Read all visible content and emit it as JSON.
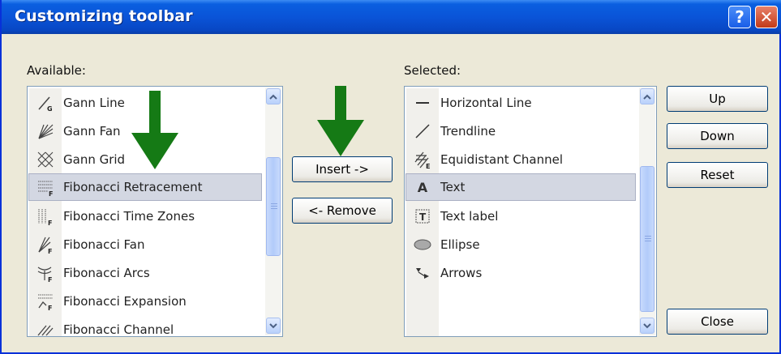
{
  "window": {
    "title": "Customizing toolbar",
    "help_label": "?",
    "close_label": "✕"
  },
  "available": {
    "label": "Available:",
    "items": [
      {
        "label": "Gann Line",
        "icon": "gann-line-icon"
      },
      {
        "label": "Gann Fan",
        "icon": "gann-fan-icon"
      },
      {
        "label": "Gann Grid",
        "icon": "gann-grid-icon"
      },
      {
        "label": "Fibonacci Retracement",
        "icon": "fibonacci-retracement-icon",
        "selected": true
      },
      {
        "label": "Fibonacci Time Zones",
        "icon": "fibonacci-time-zones-icon"
      },
      {
        "label": "Fibonacci Fan",
        "icon": "fibonacci-fan-icon"
      },
      {
        "label": "Fibonacci Arcs",
        "icon": "fibonacci-arcs-icon"
      },
      {
        "label": "Fibonacci Expansion",
        "icon": "fibonacci-expansion-icon"
      },
      {
        "label": "Fibonacci Channel",
        "icon": "fibonacci-channel-icon"
      }
    ]
  },
  "selected": {
    "label": "Selected:",
    "items": [
      {
        "label": "Horizontal Line",
        "icon": "horizontal-line-icon"
      },
      {
        "label": "Trendline",
        "icon": "trendline-icon"
      },
      {
        "label": "Equidistant Channel",
        "icon": "equidistant-channel-icon"
      },
      {
        "label": "Text",
        "icon": "text-icon",
        "selected": true
      },
      {
        "label": "Text label",
        "icon": "text-label-icon"
      },
      {
        "label": "Ellipse",
        "icon": "ellipse-icon"
      },
      {
        "label": "Arrows",
        "icon": "arrows-icon"
      }
    ]
  },
  "buttons": {
    "insert": "Insert ->",
    "remove": "<- Remove",
    "up": "Up",
    "down": "Down",
    "reset": "Reset",
    "close": "Close"
  },
  "colors": {
    "title_bar": "#0a54d8",
    "selection": "#d3d7e2",
    "annotation_arrow": "#157a15"
  }
}
